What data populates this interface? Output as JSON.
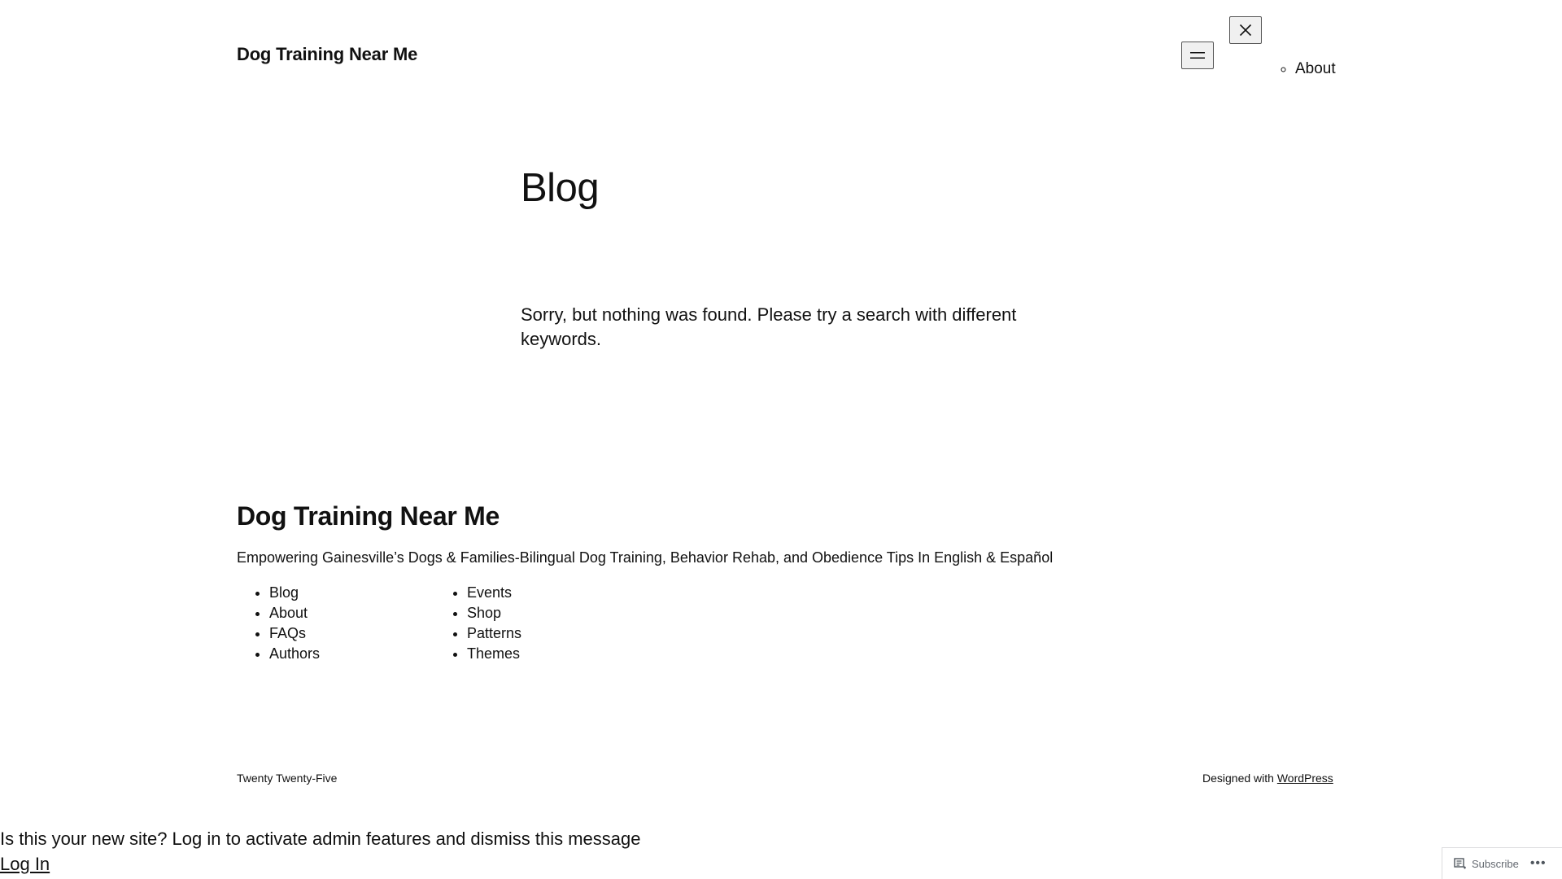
{
  "header": {
    "site_title": "Dog Training Near Me",
    "nav_sub_items": [
      {
        "label": "About"
      }
    ]
  },
  "main": {
    "heading": "Blog",
    "empty_message": "Sorry, but nothing was found. Please try a search with different keywords."
  },
  "footer": {
    "site_title": "Dog Training Near Me",
    "description": "Empowering Gainesville’s Dogs & Families-Bilingual Dog Training, Behavior Rehab, and Obedience Tips In English & Español",
    "nav_col1": [
      {
        "label": "Blog"
      },
      {
        "label": "About"
      },
      {
        "label": "FAQs"
      },
      {
        "label": "Authors"
      }
    ],
    "nav_col2": [
      {
        "label": "Events"
      },
      {
        "label": "Shop"
      },
      {
        "label": "Patterns"
      },
      {
        "label": "Themes"
      }
    ],
    "theme_credit": "Twenty Twenty-Five",
    "designed_with": "Designed with",
    "wordpress_link": "WordPress"
  },
  "admin_notice": {
    "message": "Is this your new site? Log in to activate admin features and dismiss this message",
    "login_label": "Log In"
  },
  "subscribe_bar": {
    "subscribe_label": "Subscribe",
    "more_label": "•••",
    "icons": [
      "reader-icon",
      "more-icon"
    ]
  },
  "icons": {
    "menu": "hamburger-menu-icon",
    "close": "close-icon"
  }
}
